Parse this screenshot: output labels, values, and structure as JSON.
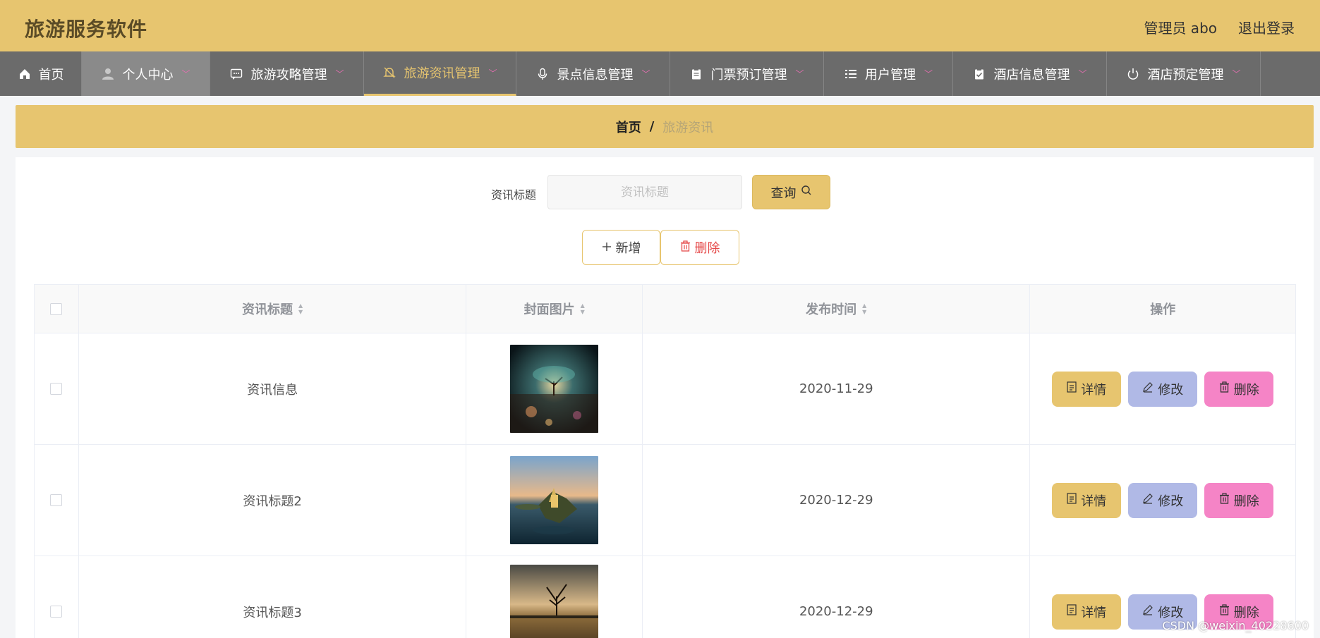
{
  "app": {
    "title": "旅游服务软件"
  },
  "user": {
    "label": "管理员 abo",
    "logout": "退出登录"
  },
  "nav": [
    {
      "label": "首页",
      "icon": "home-icon",
      "has_caret": false
    },
    {
      "label": "个人中心",
      "icon": "person-icon",
      "has_caret": true
    },
    {
      "label": "旅游攻略管理",
      "icon": "chat-icon",
      "has_caret": true
    },
    {
      "label": "旅游资讯管理",
      "icon": "bell-off-icon",
      "has_caret": true,
      "active": true
    },
    {
      "label": "景点信息管理",
      "icon": "microphone-icon",
      "has_caret": true
    },
    {
      "label": "门票预订管理",
      "icon": "clipboard-icon",
      "has_caret": true
    },
    {
      "label": "用户管理",
      "icon": "list-icon",
      "has_caret": true
    },
    {
      "label": "酒店信息管理",
      "icon": "clipboard-check-icon",
      "has_caret": true
    },
    {
      "label": "酒店预定管理",
      "icon": "power-icon",
      "has_caret": true
    }
  ],
  "breadcrumb": {
    "home": "首页",
    "separator": "/",
    "current": "旅游资讯"
  },
  "search": {
    "label": "资讯标题",
    "placeholder": "资讯标题",
    "value": "",
    "button": "查询"
  },
  "actions": {
    "add": "新增",
    "delete": "删除"
  },
  "table": {
    "headers": {
      "title": "资讯标题",
      "cover": "封面图片",
      "date": "发布时间",
      "ops": "操作"
    },
    "rows": [
      {
        "title": "资讯信息",
        "date": "2020-11-29",
        "image": "glowing-tree-night"
      },
      {
        "title": "资讯标题2",
        "date": "2020-12-29",
        "image": "lake-island-castle"
      },
      {
        "title": "资讯标题3",
        "date": "2020-12-29",
        "image": "lone-tree-lake"
      }
    ],
    "row_buttons": {
      "detail": "详情",
      "edit": "修改",
      "delete": "删除"
    }
  },
  "watermark": "CSDN @weixin_40228600",
  "colors": {
    "header": "#e7c56f",
    "nav": "#6b6b6b",
    "detail": "#e7c56f",
    "edit": "#b0b9e6",
    "delete": "#f584c6"
  }
}
